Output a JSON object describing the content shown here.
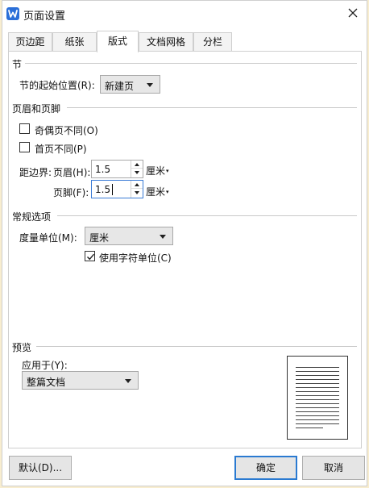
{
  "window": {
    "title": "页面设置"
  },
  "tabs": [
    {
      "label": "页边距"
    },
    {
      "label": "纸张"
    },
    {
      "label": "版式"
    },
    {
      "label": "文档网格"
    },
    {
      "label": "分栏"
    }
  ],
  "active_tab": "版式",
  "section": {
    "heading": "节",
    "start_label": "节的起始位置(R):",
    "start_value": "新建页"
  },
  "header_footer": {
    "heading": "页眉和页脚",
    "odd_even_label": "奇偶页不同(O)",
    "odd_even_checked": false,
    "first_page_label": "首页不同(P)",
    "first_page_checked": false,
    "margin_label": "距边界:",
    "header_label": "页眉(H):",
    "header_value": "1.5",
    "header_unit": "厘米",
    "footer_label": "页脚(F):",
    "footer_value": "1.5",
    "footer_unit": "厘米",
    "dropdown_caret": "▾"
  },
  "general": {
    "heading": "常规选项",
    "unit_label": "度量单位(M):",
    "unit_value": "厘米",
    "char_unit_label": "使用字符单位(C)",
    "char_unit_checked": true
  },
  "preview": {
    "heading": "预览",
    "apply_label": "应用于(Y):",
    "apply_value": "整篇文档"
  },
  "buttons": {
    "default": "默认(D)...",
    "ok": "确定",
    "cancel": "取消"
  },
  "colors": {
    "desktop": "#f8edcf",
    "primary_border": "#2a7ad1",
    "app_icon": "#2b6fd8"
  }
}
